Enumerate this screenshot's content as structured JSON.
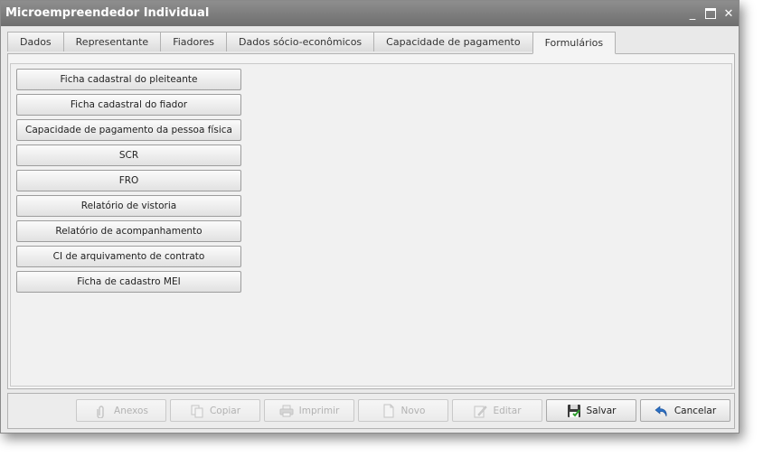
{
  "window": {
    "title": "Microempreendedor Individual"
  },
  "window_controls": {
    "minimize": "_",
    "maximize": "▭",
    "close": "✕"
  },
  "tabs": [
    {
      "label": "Dados"
    },
    {
      "label": "Representante"
    },
    {
      "label": "Fiadores"
    },
    {
      "label": "Dados sócio-econômicos"
    },
    {
      "label": "Capacidade de pagamento"
    },
    {
      "label": "Formulários",
      "active": true
    }
  ],
  "forms": [
    "Ficha cadastral do pleiteante",
    "Ficha cadastral do fiador",
    "Capacidade de pagamento da pessoa física",
    "SCR",
    "FRO",
    "Relatório de vistoria",
    "Relatório de acompanhamento",
    "CI de arquivamento de contrato",
    "Ficha de cadastro MEI"
  ],
  "actions": [
    {
      "label": "Anexos",
      "icon": "paperclip-icon",
      "enabled": false
    },
    {
      "label": "Copiar",
      "icon": "copy-icon",
      "enabled": false
    },
    {
      "label": "Imprimir",
      "icon": "printer-icon",
      "enabled": false
    },
    {
      "label": "Novo",
      "icon": "new-document-icon",
      "enabled": false
    },
    {
      "label": "Editar",
      "icon": "pencil-icon",
      "enabled": false
    },
    {
      "label": "Salvar",
      "icon": "save-icon",
      "enabled": true
    },
    {
      "label": "Cancelar",
      "icon": "undo-icon",
      "enabled": true
    }
  ]
}
